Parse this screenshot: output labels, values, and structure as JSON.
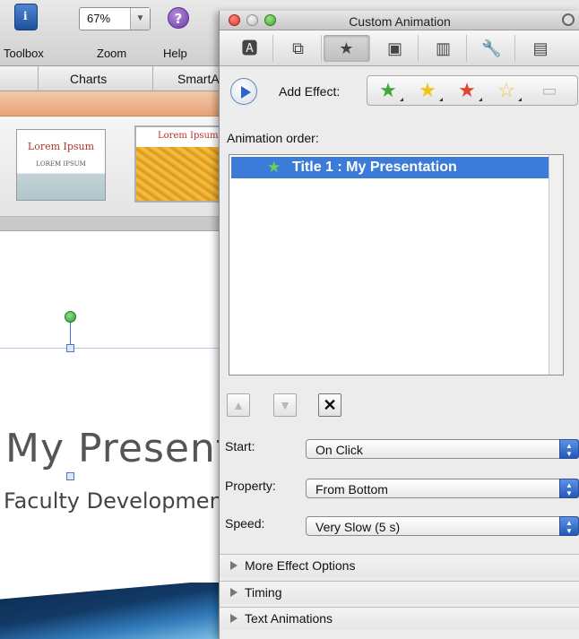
{
  "toolbar": {
    "toolbox_label": "Toolbox",
    "zoom_label": "Zoom",
    "zoom_value": "67%",
    "help_label": "Help"
  },
  "ribbon": {
    "tabs": [
      "Charts",
      "SmartArt"
    ]
  },
  "gallery": {
    "thumb1_title": "Lorem Ipsum",
    "thumb1_subtitle": "LOREM IPSUM",
    "thumb2_title": "Lorem Ipsum"
  },
  "slide": {
    "title": "My Presentation",
    "subtitle": "Faculty Development"
  },
  "palette": {
    "window_title": "Custom Animation",
    "add_effect_label": "Add Effect:",
    "animation_order_label": "Animation order:",
    "animation_items": [
      {
        "label": "Title 1 : My Presentation",
        "selected": true
      }
    ],
    "start_label": "Start:",
    "start_value": "On Click",
    "property_label": "Property:",
    "property_value": "From Bottom",
    "speed_label": "Speed:",
    "speed_value": "Very Slow (5 s)",
    "sections": [
      "More Effect Options",
      "Timing",
      "Text Animations"
    ]
  },
  "colors": {
    "selection": "#3d7bd8",
    "entrance_star": "#6bd05a",
    "emphasis_star": "#f0c419",
    "exit_star": "#e0462b"
  }
}
